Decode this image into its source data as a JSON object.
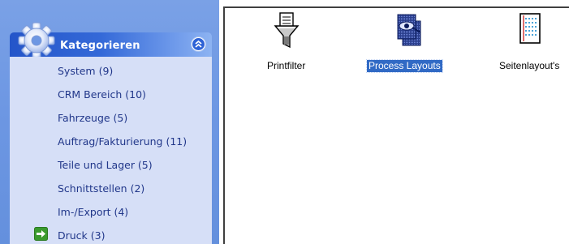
{
  "sidebar": {
    "header": {
      "title": "Kategorieren",
      "collapse_icon": "double-chevron-up-icon"
    },
    "items": [
      {
        "label": "System (9)"
      },
      {
        "label": "CRM Bereich (10)"
      },
      {
        "label": "Fahrzeuge (5)"
      },
      {
        "label": "Auftrag/Fakturierung (11)"
      },
      {
        "label": "Teile und Lager (5)"
      },
      {
        "label": "Schnittstellen (2)"
      },
      {
        "label": "Im-/Export (4)"
      },
      {
        "label": "Druck (3)",
        "active": true,
        "icon": "green-arrow-right-icon"
      }
    ]
  },
  "content": {
    "icons": [
      {
        "label": "Printfilter",
        "icon": "printfilter-icon",
        "selected": false
      },
      {
        "label": "Process Layouts",
        "icon": "process-layouts-icon",
        "selected": true
      },
      {
        "label": "Seitenlayout's",
        "icon": "page-layout-icon",
        "selected": false
      }
    ]
  },
  "colors": {
    "sidebar_bg": "#6d97e3",
    "panel_bg": "#d6dff7",
    "header_dark": "#2455c9",
    "selection": "#316ac5",
    "item_text": "#21378a"
  }
}
